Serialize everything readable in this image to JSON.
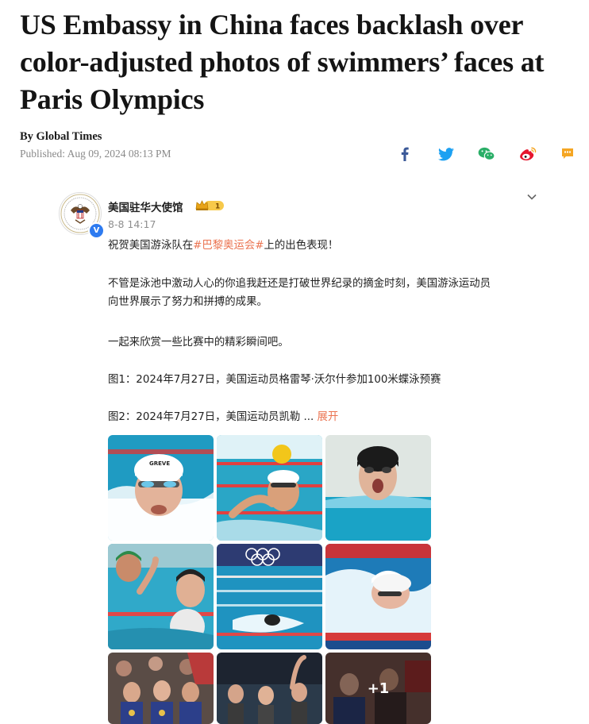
{
  "article": {
    "headline": "US Embassy in China faces backlash over color-adjusted photos of swimmers’ faces at Paris Olympics",
    "byline": "By Global Times",
    "published": "Published: Aug 09, 2024 08:13 PM"
  },
  "share_icons": [
    "facebook-icon",
    "twitter-icon",
    "wechat-icon",
    "weibo-icon",
    "comment-icon"
  ],
  "colors": {
    "facebook": "#3b5998",
    "twitter": "#1da1f2",
    "wechat": "#2aae67",
    "weibo": "#e6162d",
    "comment": "#f5a623",
    "tag": "#eb7350",
    "verify": "#2e7bf0"
  },
  "post": {
    "account_name": "美国驻华大使馆",
    "level_badge": "1",
    "time": "8-8 14:17",
    "line1_pre": "祝贺美国游泳队在",
    "line1_tag": "#巴黎奥运会#",
    "line1_post": "上的出色表现！",
    "para2_line1": "不管是泳池中激动人心的你追我赶还是打破世界纪录的摘金时刻，美国游泳运动员",
    "para2_line2": "向世界展示了努力和拼搏的成果。",
    "para3": "一起来欣赏一些比赛中的精彩瞬间吧。",
    "caption1": "图1：2024年7月27日，美国运动员格雷琴·沃尔什参加100米蝶泳预赛",
    "caption2": "图2：2024年7月27日，美国运动员凯勒 ...",
    "expand": "展开",
    "more_count": "+1",
    "photo_cap_text": "GREVE"
  }
}
